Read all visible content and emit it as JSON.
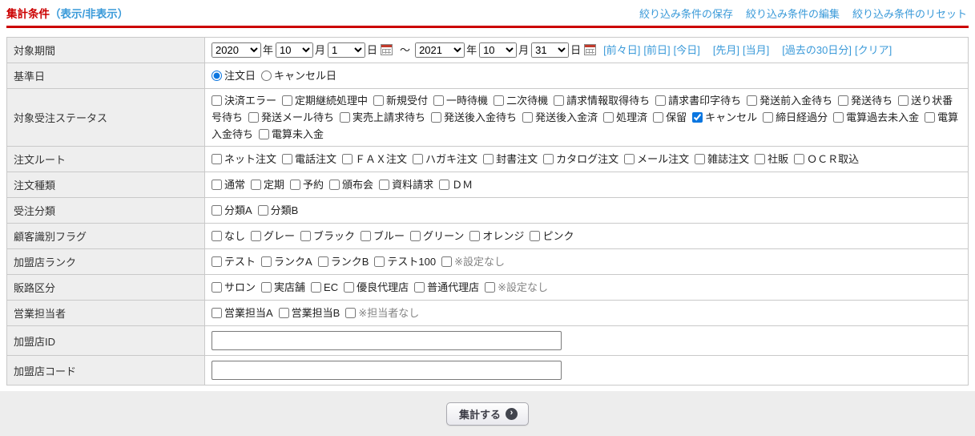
{
  "header": {
    "title": "集計条件",
    "toggle_link": "（表示/非表示）",
    "links": [
      "絞り込み条件の保存",
      "絞り込み条件の編集",
      "絞り込み条件のリセット"
    ]
  },
  "colors": {
    "accent_red": "#cc0000",
    "link_blue": "#3a9ad9",
    "label_bg": "#eeeeee",
    "border": "#c9c9c9",
    "footer_bg": "#ededed",
    "checked_blue": "#0b76e0"
  },
  "form": {
    "rows": [
      {
        "type": "period",
        "label": "対象期間",
        "from": {
          "year": "2020",
          "month": "10",
          "day": "1"
        },
        "to": {
          "year": "2021",
          "month": "10",
          "day": "31"
        },
        "year_suffix": "年",
        "month_suffix": "月",
        "day_suffix": "日",
        "separator": "～",
        "calendar_icon": "calendar-icon",
        "link_groups": [
          [
            "[前々日]",
            "[前日]",
            "[今日]"
          ],
          [
            "[先月]",
            "[当月]"
          ],
          [
            "[過去の30日分]",
            "[クリア]"
          ]
        ]
      },
      {
        "type": "radio",
        "label": "基準日",
        "group": "base-date",
        "options": [
          {
            "label": "注文日",
            "checked": true
          },
          {
            "label": "キャンセル日",
            "checked": false
          }
        ]
      },
      {
        "type": "checkbox",
        "label": "対象受注ステータス",
        "options": [
          {
            "label": "決済エラー",
            "checked": false
          },
          {
            "label": "定期継続処理中",
            "checked": false
          },
          {
            "label": "新規受付",
            "checked": false
          },
          {
            "label": "一時待機",
            "checked": false
          },
          {
            "label": "二次待機",
            "checked": false
          },
          {
            "label": "請求情報取得待ち",
            "checked": false
          },
          {
            "label": "請求書印字待ち",
            "checked": false
          },
          {
            "label": "発送前入金待ち",
            "checked": false
          },
          {
            "label": "発送待ち",
            "checked": false
          },
          {
            "label": "送り状番号待ち",
            "checked": false
          },
          {
            "label": "発送メール待ち",
            "checked": false
          },
          {
            "label": "実売上請求待ち",
            "checked": false
          },
          {
            "label": "発送後入金待ち",
            "checked": false
          },
          {
            "label": "発送後入金済",
            "checked": false
          },
          {
            "label": "処理済",
            "checked": false
          },
          {
            "label": "保留",
            "checked": false
          },
          {
            "label": "キャンセル",
            "checked": true
          },
          {
            "label": "締日経過分",
            "checked": false
          },
          {
            "label": "電算過去未入金",
            "checked": false
          },
          {
            "label": "電算入金待ち",
            "checked": false
          },
          {
            "label": "電算未入金",
            "checked": false
          }
        ]
      },
      {
        "type": "checkbox",
        "label": "注文ルート",
        "options": [
          {
            "label": "ネット注文",
            "checked": false
          },
          {
            "label": "電話注文",
            "checked": false
          },
          {
            "label": "ＦＡＸ注文",
            "checked": false
          },
          {
            "label": "ハガキ注文",
            "checked": false
          },
          {
            "label": "封書注文",
            "checked": false
          },
          {
            "label": "カタログ注文",
            "checked": false
          },
          {
            "label": "メール注文",
            "checked": false
          },
          {
            "label": "雑誌注文",
            "checked": false
          },
          {
            "label": "社販",
            "checked": false
          },
          {
            "label": "ＯＣＲ取込",
            "checked": false
          }
        ]
      },
      {
        "type": "checkbox",
        "label": "注文種類",
        "options": [
          {
            "label": "通常",
            "checked": false
          },
          {
            "label": "定期",
            "checked": false
          },
          {
            "label": "予約",
            "checked": false
          },
          {
            "label": "頒布会",
            "checked": false
          },
          {
            "label": "資料請求",
            "checked": false
          },
          {
            "label": "ＤＭ",
            "checked": false
          }
        ]
      },
      {
        "type": "checkbox",
        "label": "受注分類",
        "options": [
          {
            "label": "分類A",
            "checked": false
          },
          {
            "label": "分類B",
            "checked": false
          }
        ]
      },
      {
        "type": "checkbox",
        "label": "顧客識別フラグ",
        "options": [
          {
            "label": "なし",
            "checked": false
          },
          {
            "label": "グレー",
            "checked": false
          },
          {
            "label": "ブラック",
            "checked": false
          },
          {
            "label": "ブルー",
            "checked": false
          },
          {
            "label": "グリーン",
            "checked": false
          },
          {
            "label": "オレンジ",
            "checked": false
          },
          {
            "label": "ピンク",
            "checked": false
          }
        ]
      },
      {
        "type": "checkbox",
        "label": "加盟店ランク",
        "options": [
          {
            "label": "テスト",
            "checked": false
          },
          {
            "label": "ランクA",
            "checked": false
          },
          {
            "label": "ランクB",
            "checked": false
          },
          {
            "label": "テスト100",
            "checked": false
          },
          {
            "label": "※設定なし",
            "checked": false,
            "muted": true
          }
        ]
      },
      {
        "type": "checkbox",
        "label": "販路区分",
        "options": [
          {
            "label": "サロン",
            "checked": false
          },
          {
            "label": "実店舗",
            "checked": false
          },
          {
            "label": "EC",
            "checked": false
          },
          {
            "label": "優良代理店",
            "checked": false
          },
          {
            "label": "普通代理店",
            "checked": false
          },
          {
            "label": "※設定なし",
            "checked": false,
            "muted": true
          }
        ]
      },
      {
        "type": "checkbox",
        "label": "営業担当者",
        "options": [
          {
            "label": "営業担当A",
            "checked": false
          },
          {
            "label": "営業担当B",
            "checked": false
          },
          {
            "label": "※担当者なし",
            "checked": false,
            "muted": true
          }
        ]
      },
      {
        "type": "text",
        "label": "加盟店ID",
        "value": "",
        "placeholder": ""
      },
      {
        "type": "text",
        "label": "加盟店コード",
        "value": "",
        "placeholder": ""
      }
    ]
  },
  "footer": {
    "submit_label": "集計する",
    "submit_icon": "arrow-circle-icon"
  }
}
